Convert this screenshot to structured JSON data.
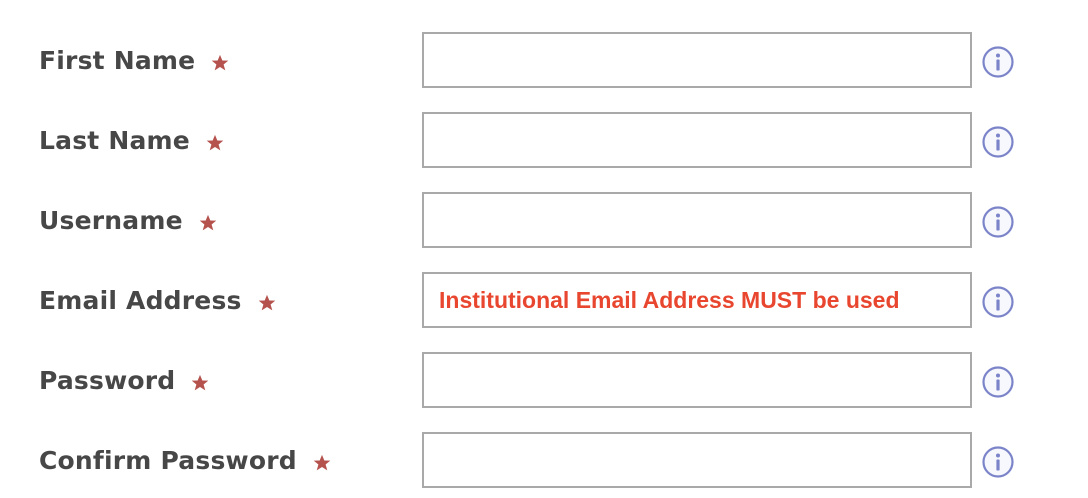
{
  "form": {
    "rows": [
      {
        "label": "First Name",
        "value": ""
      },
      {
        "label": "Last Name",
        "value": ""
      },
      {
        "label": "Username",
        "value": ""
      },
      {
        "label": "Email Address",
        "value": "Institutional Email Address MUST be used"
      },
      {
        "label": "Password",
        "value": ""
      },
      {
        "label": "Confirm Password",
        "value": ""
      }
    ]
  },
  "icons": {
    "required": "star-icon",
    "info": "info-icon"
  },
  "colors": {
    "label": "#474747",
    "required_star": "#b5524e",
    "field_border": "#a9a9a9",
    "error_text": "#e8462f",
    "info_icon": "#7b84c9"
  }
}
